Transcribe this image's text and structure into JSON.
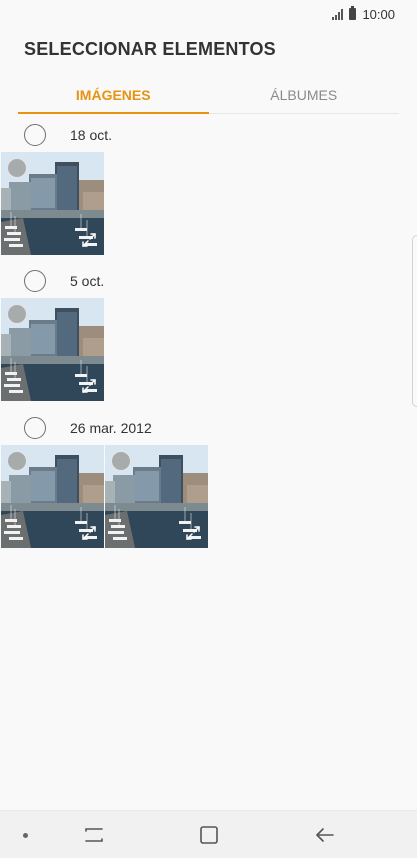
{
  "status": {
    "time": "10:00"
  },
  "header": {
    "title": "SELECCIONAR ELEMENTOS"
  },
  "tabs": [
    {
      "label": "IMÁGENES",
      "active": true
    },
    {
      "label": "ÁLBUMES",
      "active": false
    }
  ],
  "groups": [
    {
      "date": "18 oct.",
      "photos": 1
    },
    {
      "date": "5 oct.",
      "photos": 1
    },
    {
      "date": "26 mar. 2012",
      "photos": 2
    }
  ],
  "icons": {
    "select": "circle-outline-icon",
    "expand": "expand-arrows-icon",
    "recents": "recents-icon",
    "home": "home-square-icon",
    "back": "back-arrow-icon"
  },
  "colors": {
    "accent": "#e8920f",
    "background": "#f9f9f9"
  }
}
